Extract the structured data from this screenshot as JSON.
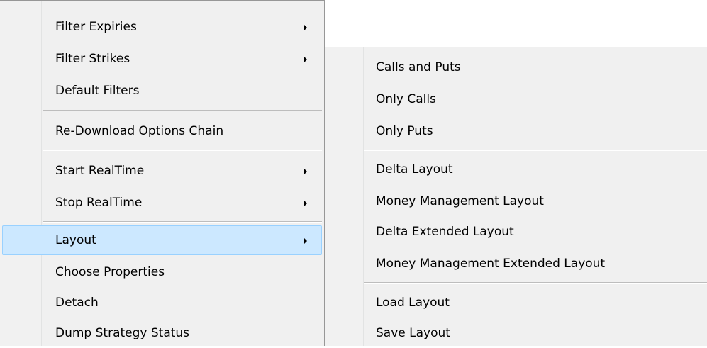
{
  "main_menu": {
    "filter_expiries": "Filter Expiries",
    "filter_strikes": "Filter Strikes",
    "default_filters": "Default Filters",
    "redownload_options_chain": "Re-Download Options Chain",
    "start_realtime": "Start RealTime",
    "stop_realtime": "Stop RealTime",
    "layout": "Layout",
    "choose_properties": "Choose Properties",
    "detach": "Detach",
    "dump_strategy_status": "Dump Strategy Status"
  },
  "layout_submenu": {
    "calls_and_puts": "Calls and Puts",
    "only_calls": "Only Calls",
    "only_puts": "Only Puts",
    "delta_layout": "Delta Layout",
    "money_management_layout": "Money Management Layout",
    "delta_extended_layout": "Delta Extended Layout",
    "money_management_extended_layout": "Money Management Extended Layout",
    "load_layout": "Load Layout",
    "save_layout": "Save Layout"
  },
  "colors": {
    "menu_background": "#f0f0f0",
    "menu_border": "#979797",
    "selection_background": "#cce8ff",
    "selection_border": "#99d1ff",
    "separator": "#bdbdbd"
  }
}
